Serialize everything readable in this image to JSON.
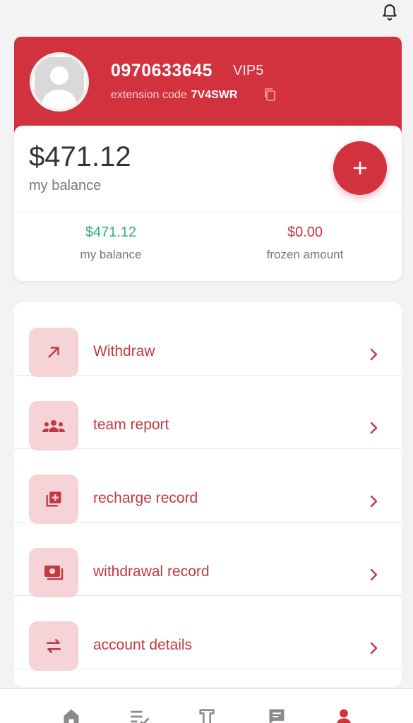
{
  "profile": {
    "phone": "0970633645",
    "vip": "VIP5",
    "extension_label": "extension code",
    "extension_code": "7V4SWR"
  },
  "balance": {
    "amount": "$471.12",
    "label": "my balance",
    "stats": [
      {
        "value": "$471.12",
        "label": "my balance"
      },
      {
        "value": "$0.00",
        "label": "frozen amount"
      }
    ]
  },
  "menu": [
    {
      "label": "Withdraw",
      "icon": "arrow-up-right-icon"
    },
    {
      "label": "team report",
      "icon": "team-icon"
    },
    {
      "label": "recharge record",
      "icon": "add-layers-icon"
    },
    {
      "label": "withdrawal record",
      "icon": "cash-icon"
    },
    {
      "label": "account details",
      "icon": "swap-icon"
    }
  ],
  "nav": [
    {
      "icon": "home-icon"
    },
    {
      "icon": "task-list-icon"
    },
    {
      "icon": "service-icon"
    },
    {
      "icon": "message-icon"
    },
    {
      "icon": "profile-icon"
    }
  ],
  "colors": {
    "brand": "#d2323d",
    "positive": "#2cb37a",
    "menu_icon_bg": "#f6d3d6"
  }
}
